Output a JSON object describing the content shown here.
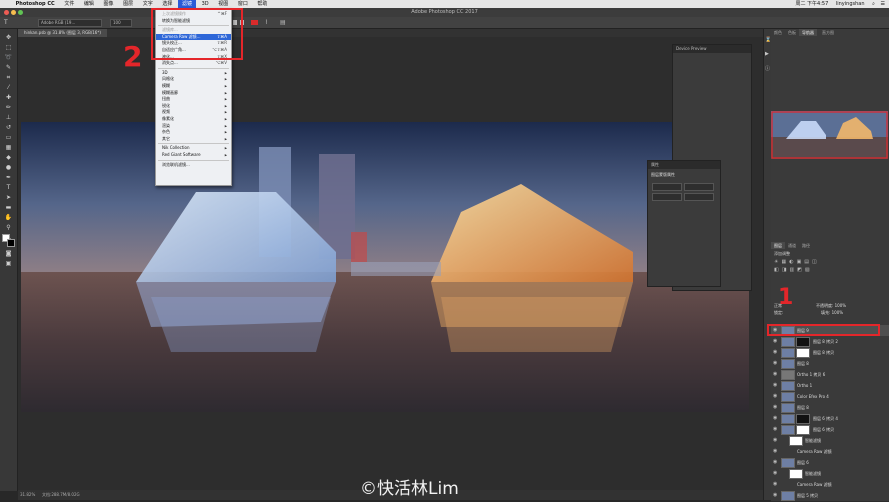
{
  "menubar": {
    "app": "Photoshop CC",
    "items": [
      "文件",
      "编辑",
      "图像",
      "图层",
      "文字",
      "选择",
      "滤镜",
      "3D",
      "视图",
      "窗口",
      "帮助"
    ],
    "active_item": "滤镜",
    "right_time": "周二 下午4:57",
    "right_user": "linyingshan"
  },
  "window": {
    "title": "Adobe Photoshop CC 2017"
  },
  "options": {
    "tool_preset": "Adobe RGB (19...",
    "tolerance": "100"
  },
  "document_tab": "hinkan.psb @ 31.8% (图层 3, RGB/16*)",
  "status": {
    "zoom": "31.82%",
    "doc_size": "文档:288.7M/8.02G"
  },
  "filter_menu": {
    "items": [
      {
        "label": "上次滤镜操作",
        "key": "^⌘F",
        "disabled": true
      },
      {
        "label": "转换为智能滤镜",
        "key": ""
      },
      {
        "sep": true
      },
      {
        "label": "滤镜库...",
        "key": "",
        "disabled": true
      },
      {
        "label": "Camera Raw 滤镜...",
        "key": "⇧⌘A",
        "selected": true
      },
      {
        "label": "镜头校正...",
        "key": "⇧⌘R"
      },
      {
        "label": "自适应广角...",
        "key": "⌥⇧⌘A"
      },
      {
        "label": "液化...",
        "key": "⇧⌘X"
      },
      {
        "label": "消失点...",
        "key": "⌥⌘V"
      },
      {
        "sep": true
      },
      {
        "label": "3D",
        "arrow": true
      },
      {
        "label": "风格化",
        "arrow": true
      },
      {
        "label": "模糊",
        "arrow": true
      },
      {
        "label": "模糊画廊",
        "arrow": true
      },
      {
        "label": "扭曲",
        "arrow": true
      },
      {
        "label": "锐化",
        "arrow": true
      },
      {
        "label": "视频",
        "arrow": true
      },
      {
        "label": "像素化",
        "arrow": true
      },
      {
        "label": "渲染",
        "arrow": true
      },
      {
        "label": "杂色",
        "arrow": true
      },
      {
        "label": "其它",
        "arrow": true
      },
      {
        "sep": true
      },
      {
        "label": "Nik Collection",
        "arrow": true
      },
      {
        "label": "Red Giant Software",
        "arrow": true
      },
      {
        "sep": true
      },
      {
        "label": "浏览联机滤镜...",
        "key": ""
      }
    ]
  },
  "panels": {
    "device_preview": "Device Preview",
    "properties": "属性",
    "properties_sub": "图层蒙版属性",
    "right_tabs": [
      "颜色",
      "色板",
      "导航器",
      "直方图"
    ],
    "layer_tabs": [
      "图层",
      "通道",
      "路径"
    ],
    "adjust_title": "添加调整",
    "opacity": "不透明度: 100%",
    "fill": "填充: 100%",
    "blend_mode": "正常",
    "lock_label": "锁定:"
  },
  "layers": [
    {
      "name": "图层 9",
      "selected": true
    },
    {
      "name": "图层 8 拷贝 2"
    },
    {
      "name": "图层 8 拷贝"
    },
    {
      "name": "图层 8"
    },
    {
      "name": "Ortho 1 拷贝 6"
    },
    {
      "name": "Ortho 1"
    },
    {
      "name": "Color Efex Pro 4"
    },
    {
      "name": "图层 8"
    },
    {
      "name": "图层 6 拷贝 4"
    },
    {
      "name": "图层 6 拷贝"
    },
    {
      "name": "智能滤镜"
    },
    {
      "name": "Camera Raw 滤镜"
    },
    {
      "name": "图层 6"
    },
    {
      "name": "智能滤镜"
    },
    {
      "name": "Camera Raw 滤镜"
    },
    {
      "name": "图层 5 拷贝"
    }
  ],
  "annotations": {
    "step1": "1",
    "step2": "2"
  },
  "watermark": "©快活林Lim",
  "colors": {
    "highlight_red": "#e4262a",
    "menu_selected": "#2e67d8"
  }
}
